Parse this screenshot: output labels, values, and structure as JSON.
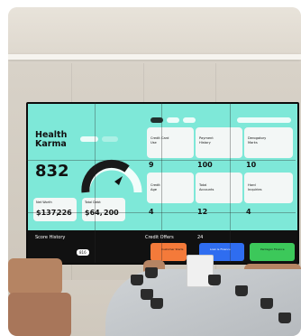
{
  "screen": {
    "brand_line1": "Health",
    "brand_line2": "Karma",
    "score": "832",
    "net_worth_label": "Net Worth",
    "net_worth_value": "$137,",
    "net_worth_cents": "226",
    "total_debt_label": "Total Debt",
    "total_debt_value": "$64,",
    "total_debt_cents": "200",
    "score_history_label": "Score History",
    "score_history_badge": "816",
    "credit_offers_label": "Credit Offers",
    "credit_offers_count": "24",
    "cards": [
      {
        "label1": "Credit Card",
        "label2": "Use",
        "value": "9"
      },
      {
        "label1": "Payment",
        "label2": "History",
        "value": "100"
      },
      {
        "label1": "Derogatory",
        "label2": "Marks",
        "value": "10"
      },
      {
        "label1": "Credit",
        "label2": "Age",
        "value": "4"
      },
      {
        "label1": "Total",
        "label2": "Accounts",
        "value": "12"
      },
      {
        "label1": "Hard",
        "label2": "Inquiries",
        "value": "4"
      }
    ],
    "offer_1": "Customer Starts",
    "offer_2": "Loan & Finance",
    "offer_3": "Pentagon Finance"
  },
  "colors": {
    "screen_teal": "#7ee8d8",
    "offer_orange": "#f47a3a",
    "offer_blue": "#2f6df0",
    "offer_green": "#3cc85a"
  }
}
